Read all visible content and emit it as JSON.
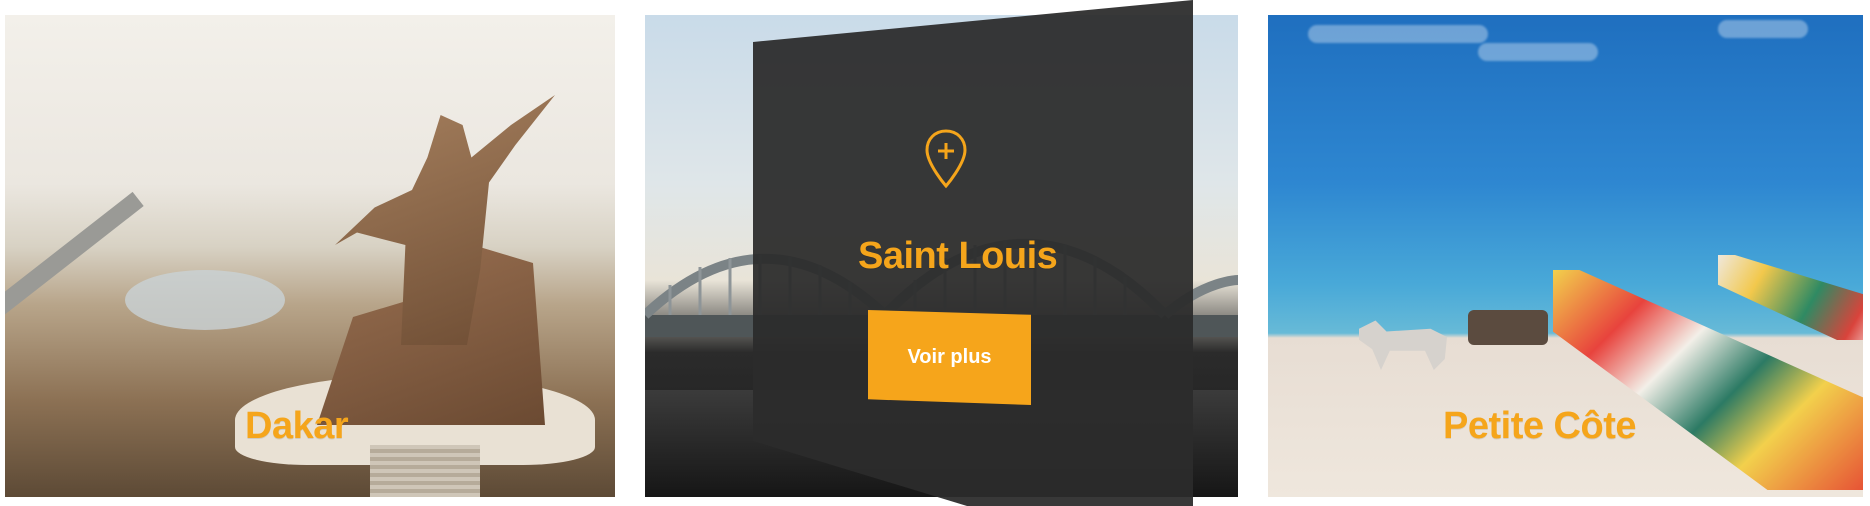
{
  "cards": {
    "dakar": {
      "title": "Dakar"
    },
    "saint_louis": {
      "title": "Saint Louis",
      "button_label": "Voir plus",
      "icon": "location-pin-plus-icon"
    },
    "petite_cote": {
      "title": "Petite Côte"
    }
  },
  "colors": {
    "accent": "#f5a51b",
    "overlay": "#2c2c2c"
  }
}
